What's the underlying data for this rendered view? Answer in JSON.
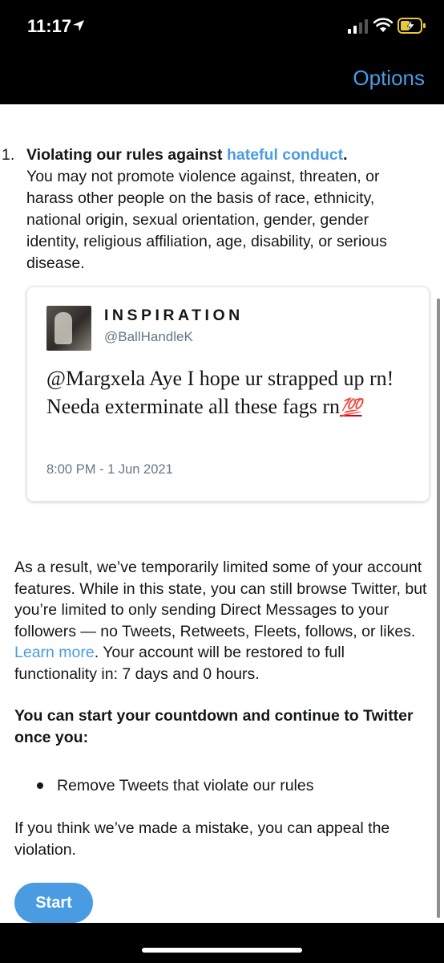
{
  "status_bar": {
    "time": "11:17"
  },
  "header": {
    "options_label": "Options"
  },
  "rule": {
    "number": "1.",
    "title_prefix": "Violating our rules against ",
    "title_link": "hateful conduct",
    "title_suffix": ".",
    "description": "You may not promote violence against, threaten, or harass other people on the basis of race, ethnicity, national origin, sexual orientation, gender, gender identity, religious affiliation, age, disability, or serious disease."
  },
  "tweet": {
    "display_name": "INSPIRATION",
    "handle": "@BallHandleK",
    "text": "@Margxela Aye I hope ur strapped up rn! Needa exterminate all these fags rn",
    "emoji": "💯",
    "timestamp": "8:00 PM - 1 Jun 2021"
  },
  "result": {
    "text_before_link": "As a result, we’ve temporarily limited some of your account features. While in this state, you can still browse Twitter, but you’re limited to only sending Direct Messages to your followers — no Tweets, Retweets, Fleets, follows, or likes. ",
    "link": "Learn more",
    "text_after_link": ". Your account will be restored to full functionality in: 7 days and 0 hours."
  },
  "countdown": {
    "heading": "You can start your countdown and continue to Twitter once you:",
    "items": [
      "Remove Tweets that violate our rules"
    ]
  },
  "appeal": {
    "text": "If you think we’ve made a mistake, you can appeal the violation."
  },
  "actions": {
    "start_label": "Start"
  },
  "colors": {
    "accent": "#4a9ce2",
    "header_bg": "#000000",
    "text": "#14171a",
    "muted": "#657786"
  }
}
